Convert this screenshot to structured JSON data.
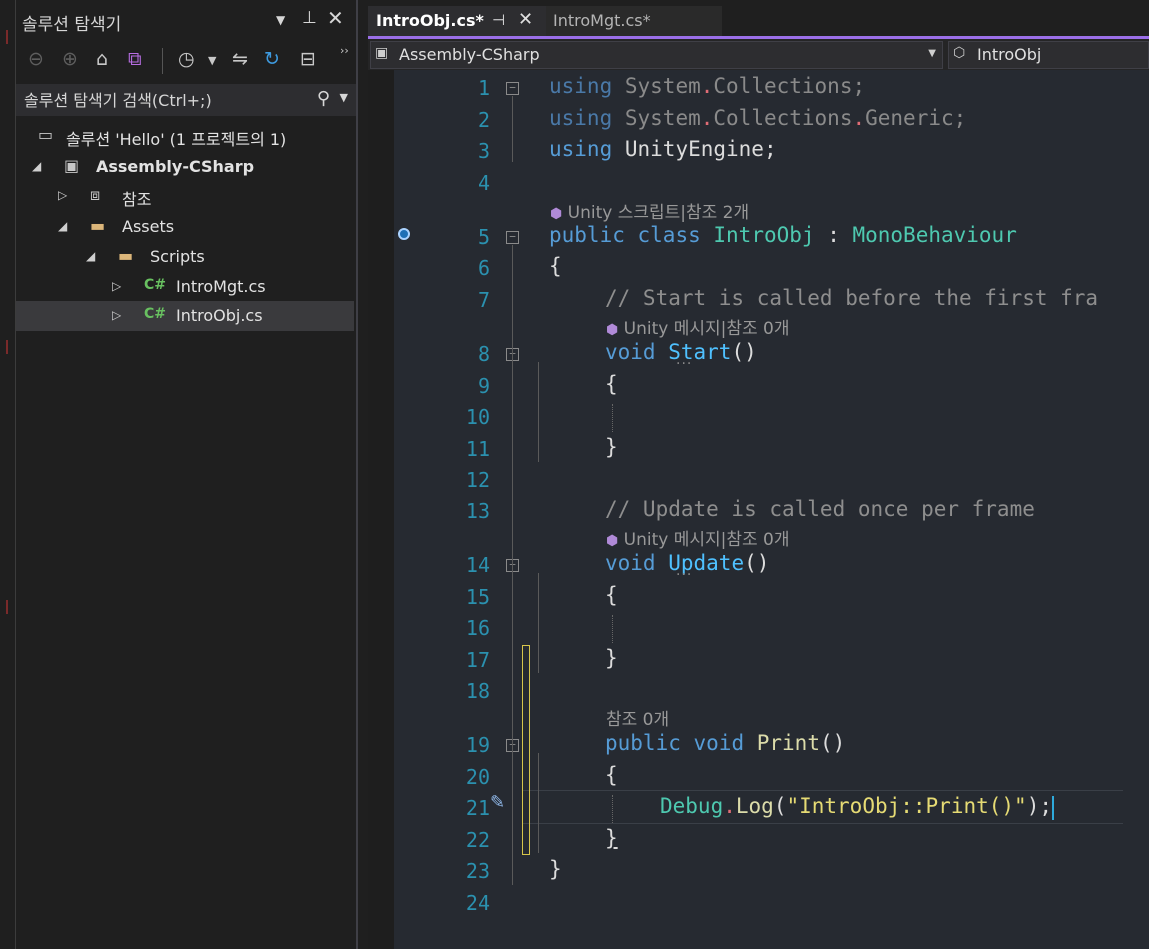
{
  "solution_explorer": {
    "title": "솔루션 탐색기",
    "search_placeholder": "솔루션 탐색기 검색(Ctrl+;)",
    "tree": [
      {
        "label": "솔루션 'Hello' (1 프로젝트의 1)",
        "icon": "solution-icon"
      },
      {
        "label": "Assembly-CSharp",
        "icon": "csharp-project-icon"
      },
      {
        "label": "참조",
        "icon": "references-icon"
      },
      {
        "label": "Assets",
        "icon": "folder-icon"
      },
      {
        "label": "Scripts",
        "icon": "folder-icon"
      },
      {
        "label": "IntroMgt.cs",
        "icon": "csharp-file-icon"
      },
      {
        "label": "IntroObj.cs",
        "icon": "csharp-file-icon"
      }
    ]
  },
  "editor": {
    "tabs": [
      {
        "label": "IntroObj.cs*",
        "active": true
      },
      {
        "label": "IntroMgt.cs*",
        "active": false
      }
    ],
    "nav": {
      "project": "Assembly-CSharp",
      "type": "IntroObj"
    },
    "line_numbers": [
      "1",
      "2",
      "3",
      "4",
      "5",
      "6",
      "7",
      "8",
      "9",
      "10",
      "11",
      "12",
      "13",
      "14",
      "15",
      "16",
      "17",
      "18",
      "19",
      "20",
      "21",
      "22",
      "23",
      "24"
    ],
    "lens": {
      "class": "Unity 스크립트|참조 2개",
      "start": "Unity 메시지|참조 0개",
      "update": "Unity 메시지|참조 0개",
      "print": "참조 0개"
    },
    "code": {
      "using": "using",
      "system": "System",
      "collections": "Collections",
      "generic": "Generic",
      "unityengine": "UnityEngine",
      "public": "public",
      "class": "class",
      "class_name": "IntroObj",
      "base_class": "MonoBehaviour",
      "comment_start": "// Start is called before the first fra",
      "void": "void",
      "start": "Start",
      "comment_update": "// Update is called once per frame",
      "update": "Update",
      "print": "Print",
      "debug": "Debug",
      "log": "Log",
      "string_literal": "\"IntroObj::Print()\""
    }
  }
}
